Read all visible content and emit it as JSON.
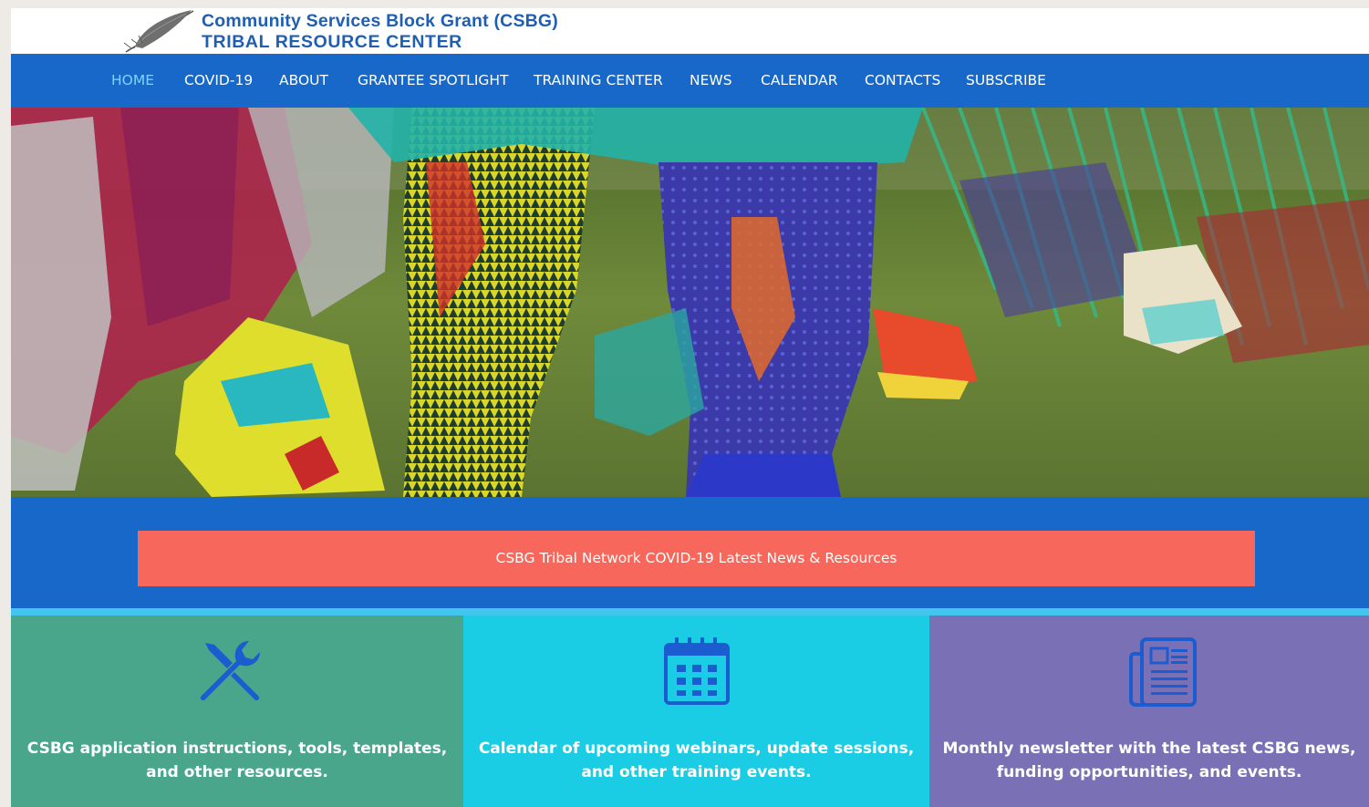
{
  "header": {
    "title_line1": "Community Services Block Grant (CSBG)",
    "title_line2": "TRIBAL RESOURCE CENTER",
    "logo_icon": "feather-icon"
  },
  "nav": {
    "items": [
      {
        "label": "HOME",
        "active": true
      },
      {
        "label": "COVID-19"
      },
      {
        "label": "ABOUT"
      },
      {
        "label": "GRANTEE SPOTLIGHT"
      },
      {
        "label": "TRAINING CENTER"
      },
      {
        "label": "NEWS"
      },
      {
        "label": "CALENDAR"
      },
      {
        "label": "CONTACTS"
      },
      {
        "label": "SUBSCRIBE"
      }
    ]
  },
  "banner": {
    "button_label": "CSBG Tribal Network COVID-19 Latest News & Resources"
  },
  "features": [
    {
      "icon": "tools-icon",
      "text": "CSBG application instructions, tools, templates, and other resources."
    },
    {
      "icon": "calendar-icon",
      "text": "Calendar of upcoming webinars, update sessions, and other training events."
    },
    {
      "icon": "newspaper-icon",
      "text": "Monthly newsletter with the latest CSBG news, funding opportunities, and events."
    }
  ],
  "colors": {
    "nav_bg": "#1768c9",
    "nav_active": "#7fd3ff",
    "banner_button": "#f7675b",
    "card_green": "#4aa68b",
    "card_cyan": "#1bcde4",
    "card_purple": "#7a70b5",
    "icon_blue": "#1c5cd1"
  }
}
